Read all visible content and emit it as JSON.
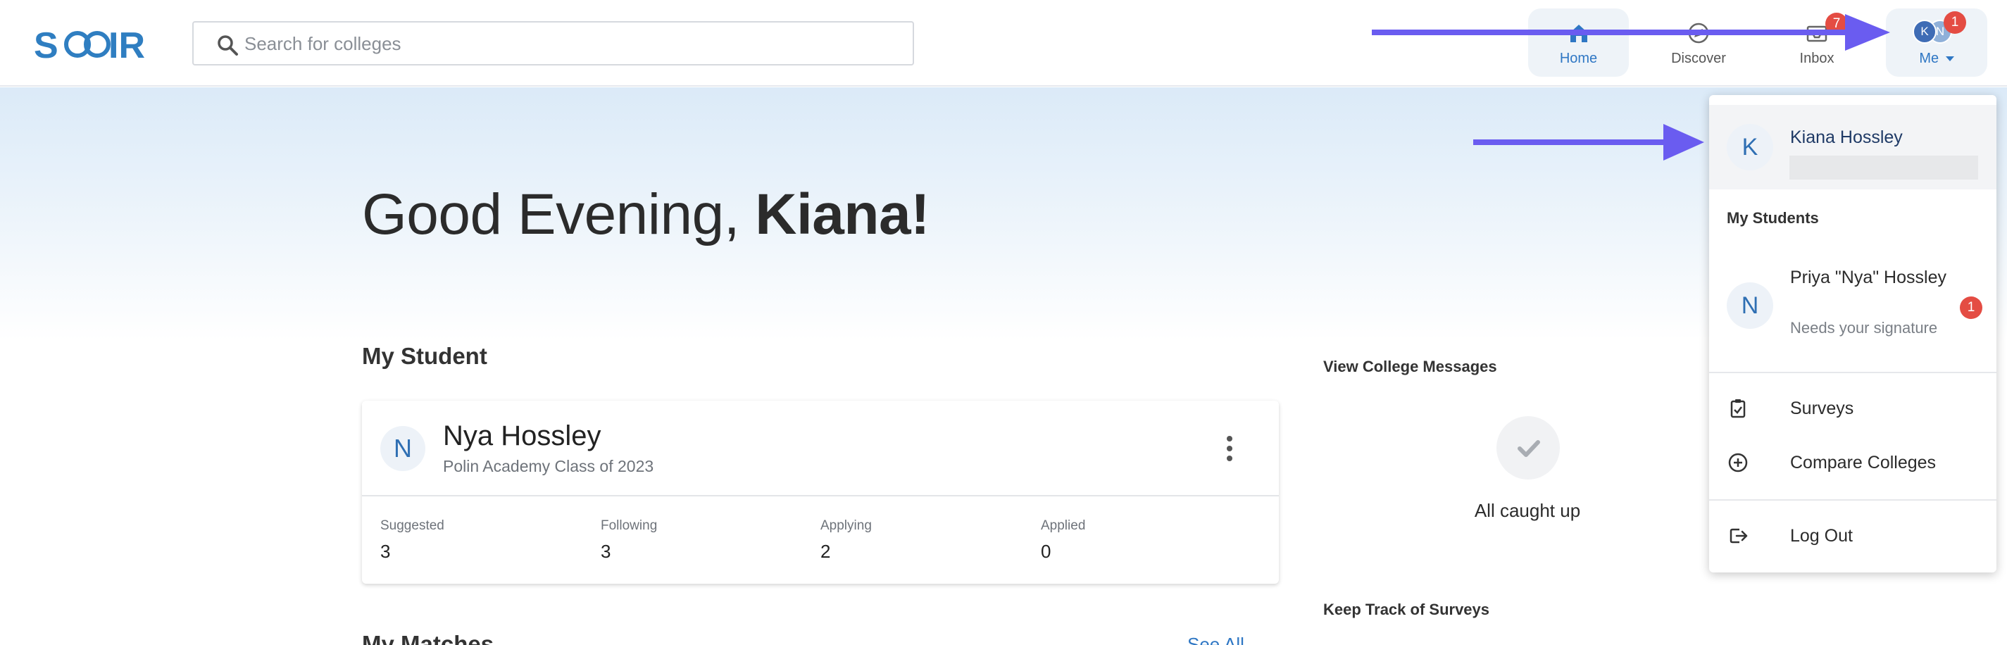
{
  "app": {
    "logo_text": "SCOIR"
  },
  "search": {
    "placeholder": "Search for colleges"
  },
  "nav": {
    "home": "Home",
    "discover": "Discover",
    "inbox": "Inbox",
    "inbox_badge": "7",
    "me": "Me",
    "me_badge": "1",
    "me_avatars": [
      "K",
      "N"
    ]
  },
  "greeting": {
    "prefix": "Good Evening, ",
    "name": "Kiana!"
  },
  "my_student": {
    "title": "My Student",
    "initial": "N",
    "name": "Nya Hossley",
    "subtitle": "Polin Academy Class of 2023",
    "stats": [
      {
        "label": "Suggested",
        "value": "3"
      },
      {
        "label": "Following",
        "value": "3"
      },
      {
        "label": "Applying",
        "value": "2"
      },
      {
        "label": "Applied",
        "value": "0"
      }
    ]
  },
  "matches": {
    "title": "My Matches",
    "see_all": "See All"
  },
  "college_messages": {
    "title": "View College Messages",
    "status": "All caught up"
  },
  "surveys_card": {
    "title": "Keep Track of Surveys"
  },
  "dropdown": {
    "user_initial": "K",
    "user_name": "Kiana Hossley",
    "section": "My Students",
    "student_initial": "N",
    "student_name": "Priya \"Nya\" Hossley",
    "student_note": "Needs your signature",
    "student_badge": "1",
    "items": [
      {
        "label": "Surveys",
        "icon": "clipboard-check-icon"
      },
      {
        "label": "Compare Colleges",
        "icon": "plus-circle-icon"
      },
      {
        "label": "Log Out",
        "icon": "logout-icon"
      }
    ]
  },
  "colors": {
    "accent": "#2f77c4",
    "logo": "#2f7ec1",
    "badge": "#e44c43",
    "arrow": "#6a5cf0"
  }
}
